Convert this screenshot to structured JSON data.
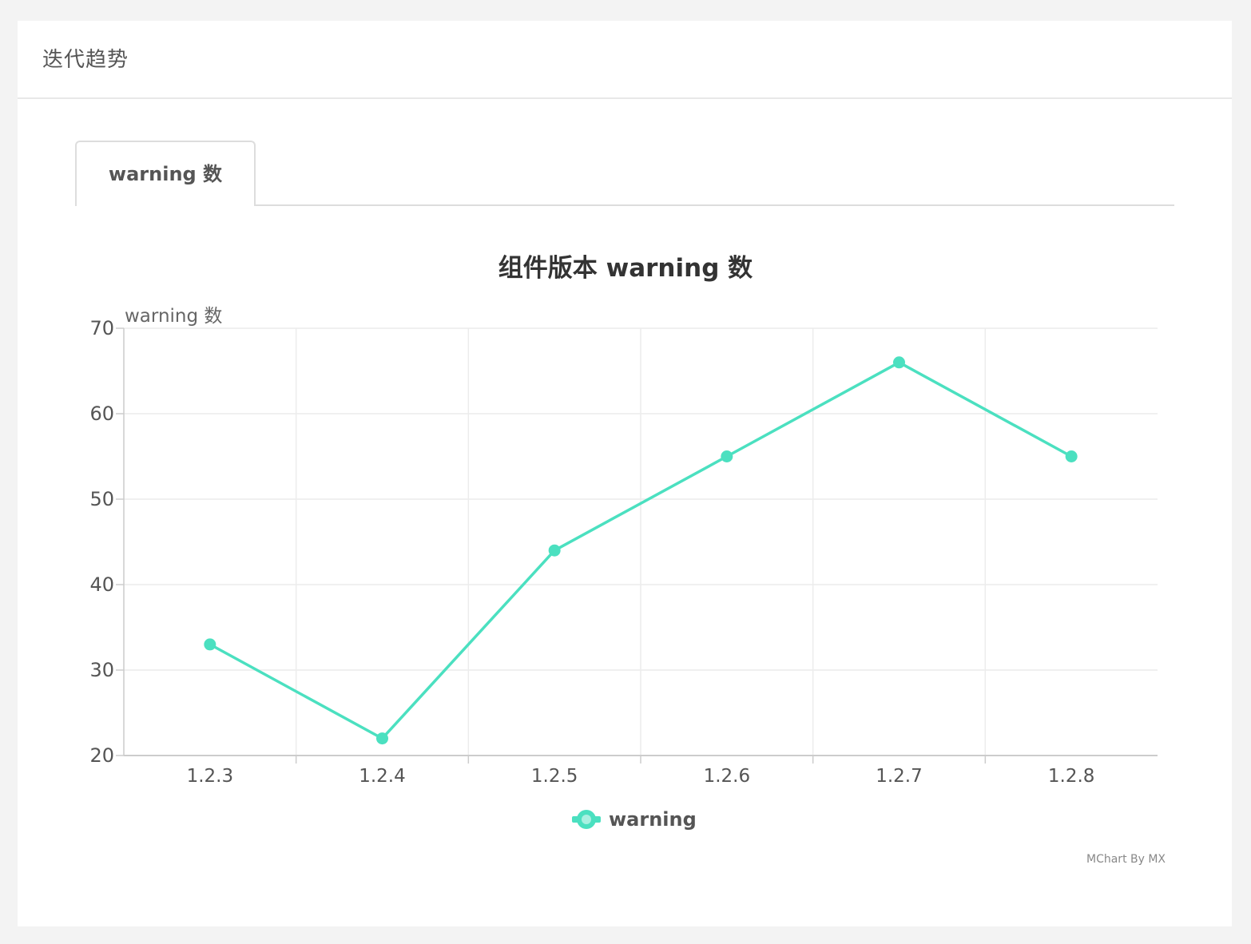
{
  "header": {
    "title": "迭代趋势"
  },
  "tabs": [
    {
      "label": "warning 数",
      "active": true
    }
  ],
  "chart_data": {
    "type": "line",
    "title": "组件版本 warning 数",
    "ylabel": "warning 数",
    "xlabel": "",
    "categories": [
      "1.2.3",
      "1.2.4",
      "1.2.5",
      "1.2.6",
      "1.2.7",
      "1.2.8"
    ],
    "series": [
      {
        "name": "warning",
        "values": [
          33,
          22,
          44,
          55,
          66,
          55
        ],
        "color": "#4be0c0"
      }
    ],
    "ylim": [
      20,
      70
    ],
    "yticks": [
      20,
      30,
      40,
      50,
      60,
      70
    ],
    "grid": true,
    "legend": "bottom-center"
  },
  "credit": "MChart By MX"
}
